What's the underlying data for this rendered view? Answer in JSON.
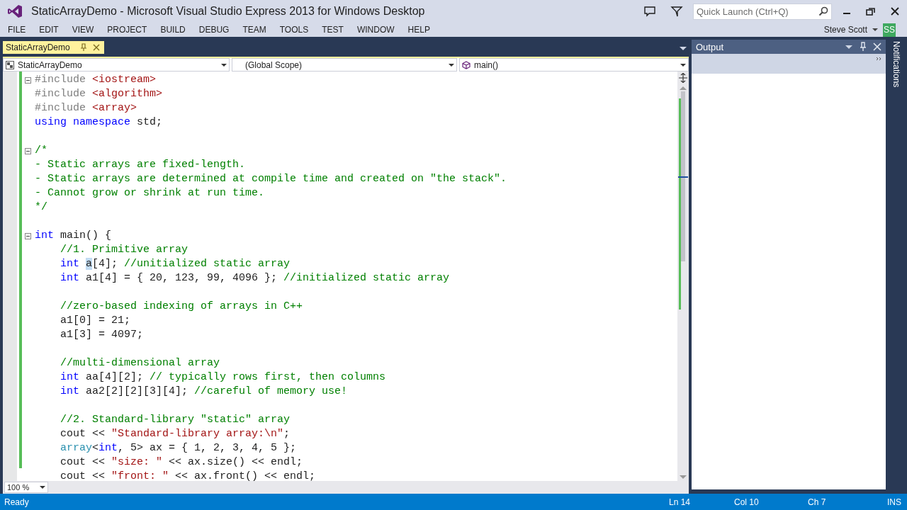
{
  "window": {
    "title": "StaticArrayDemo - Microsoft Visual Studio Express 2013 for Windows Desktop"
  },
  "quick_launch": {
    "placeholder": "Quick Launch (Ctrl+Q)"
  },
  "menu": [
    "FILE",
    "EDIT",
    "VIEW",
    "PROJECT",
    "BUILD",
    "DEBUG",
    "TEAM",
    "TOOLS",
    "TEST",
    "WINDOW",
    "HELP"
  ],
  "user": {
    "name": "Steve Scott",
    "initials": "SS"
  },
  "document_tab": {
    "label": "StaticArrayDemo",
    "selected": true
  },
  "navigation_bar": [
    {
      "kind": "project",
      "text": "StaticArrayDemo"
    },
    {
      "kind": "scope",
      "text": "(Global Scope)"
    },
    {
      "kind": "member",
      "text": "main()"
    }
  ],
  "editor": {
    "blocks": [
      {
        "lines": [
          {
            "collapsible": true,
            "tokens": [
              {
                "kind": "preproc",
                "text": "#include "
              },
              {
                "kind": "string",
                "text": "<iostream>"
              }
            ]
          },
          {
            "collapsible": false,
            "tokens": [
              {
                "kind": "preproc",
                "text": "#include "
              },
              {
                "kind": "string",
                "text": "<algorithm>"
              }
            ]
          },
          {
            "collapsible": false,
            "tokens": [
              {
                "kind": "preproc",
                "text": "#include "
              },
              {
                "kind": "string",
                "text": "<array>"
              }
            ]
          },
          {
            "collapsible": false,
            "tokens": [
              {
                "kind": "keyword",
                "text": "using namespace"
              },
              {
                "kind": "plain",
                "text": " std;"
              }
            ]
          }
        ]
      },
      {
        "lines": [
          {
            "collapsible": true,
            "tokens": [
              {
                "kind": "comment",
                "text": "/*"
              }
            ]
          },
          {
            "collapsible": false,
            "tokens": [
              {
                "kind": "comment",
                "text": "- Static arrays are fixed-length."
              }
            ]
          },
          {
            "collapsible": false,
            "tokens": [
              {
                "kind": "comment",
                "text": "- Static arrays are determined at compile time and created on \"the stack\"."
              }
            ]
          },
          {
            "collapsible": false,
            "tokens": [
              {
                "kind": "comment",
                "text": "- Cannot grow or shrink at run time."
              }
            ]
          },
          {
            "collapsible": false,
            "tokens": [
              {
                "kind": "comment",
                "text": "*/"
              }
            ]
          }
        ]
      },
      {
        "lines": [
          {
            "collapsible": true,
            "tokens": [
              {
                "kind": "keyword",
                "text": "int"
              },
              {
                "kind": "plain",
                "text": " main() {"
              }
            ]
          },
          {
            "collapsible": false,
            "tokens": [
              {
                "kind": "comment",
                "text": "    //1. Primitive array"
              }
            ]
          },
          {
            "collapsible": false,
            "tokens": [
              {
                "kind": "keyword",
                "text": "    int "
              },
              {
                "kind": "selection",
                "text": "a"
              },
              {
                "kind": "plain",
                "text": "[4]; "
              },
              {
                "kind": "comment",
                "text": "//unitialized static array"
              }
            ]
          },
          {
            "collapsible": false,
            "tokens": [
              {
                "kind": "keyword",
                "text": "    int"
              },
              {
                "kind": "plain",
                "text": " a1[4] = { 20, 123, 99, 4096 }; "
              },
              {
                "kind": "comment",
                "text": "//initialized static array"
              }
            ]
          }
        ]
      },
      {
        "lines": [
          {
            "collapsible": false,
            "tokens": [
              {
                "kind": "comment",
                "text": "    //zero-based indexing of arrays in C++"
              }
            ]
          },
          {
            "collapsible": false,
            "tokens": [
              {
                "kind": "plain",
                "text": "    a1[0] = 21;"
              }
            ]
          },
          {
            "collapsible": false,
            "tokens": [
              {
                "kind": "plain",
                "text": "    a1[3] = 4097;"
              }
            ]
          }
        ]
      },
      {
        "lines": [
          {
            "collapsible": false,
            "tokens": [
              {
                "kind": "comment",
                "text": "    //multi-dimensional array"
              }
            ]
          },
          {
            "collapsible": false,
            "tokens": [
              {
                "kind": "keyword",
                "text": "    int"
              },
              {
                "kind": "plain",
                "text": " aa[4][2]; "
              },
              {
                "kind": "comment",
                "text": "// typically rows first, then columns"
              }
            ]
          },
          {
            "collapsible": false,
            "tokens": [
              {
                "kind": "keyword",
                "text": "    int"
              },
              {
                "kind": "plain",
                "text": " aa2[2][2][3][4]; "
              },
              {
                "kind": "comment",
                "text": "//careful of memory use!"
              }
            ]
          }
        ]
      },
      {
        "lines": [
          {
            "collapsible": false,
            "tokens": [
              {
                "kind": "comment",
                "text": "    //2. Standard-library \"static\" array"
              }
            ]
          },
          {
            "collapsible": false,
            "tokens": [
              {
                "kind": "plain",
                "text": "    cout << "
              },
              {
                "kind": "string",
                "text": "\"Standard-library array:\\n\""
              },
              {
                "kind": "plain",
                "text": ";"
              }
            ]
          },
          {
            "collapsible": false,
            "tokens": [
              {
                "kind": "type",
                "text": "    array"
              },
              {
                "kind": "plain",
                "text": "<"
              },
              {
                "kind": "keyword",
                "text": "int"
              },
              {
                "kind": "plain",
                "text": ", 5> ax = { 1, 2, 3, 4, 5 };"
              }
            ]
          },
          {
            "collapsible": false,
            "tokens": [
              {
                "kind": "plain",
                "text": "    cout << "
              },
              {
                "kind": "string",
                "text": "\"size: \""
              },
              {
                "kind": "plain",
                "text": " << ax.size() << endl;"
              }
            ]
          },
          {
            "collapsible": false,
            "tokens": [
              {
                "kind": "plain",
                "text": "    cout << "
              },
              {
                "kind": "string",
                "text": "\"front: \""
              },
              {
                "kind": "plain",
                "text": " << ax.front() << endl;"
              }
            ]
          }
        ]
      }
    ],
    "zoom": "100 %"
  },
  "output_panel": {
    "title": "Output"
  },
  "side_tab": "Notifications",
  "status_bar": {
    "state": "Ready",
    "line": "Ln 14",
    "column": "Col 10",
    "char": "Ch 7",
    "mode": "INS"
  }
}
